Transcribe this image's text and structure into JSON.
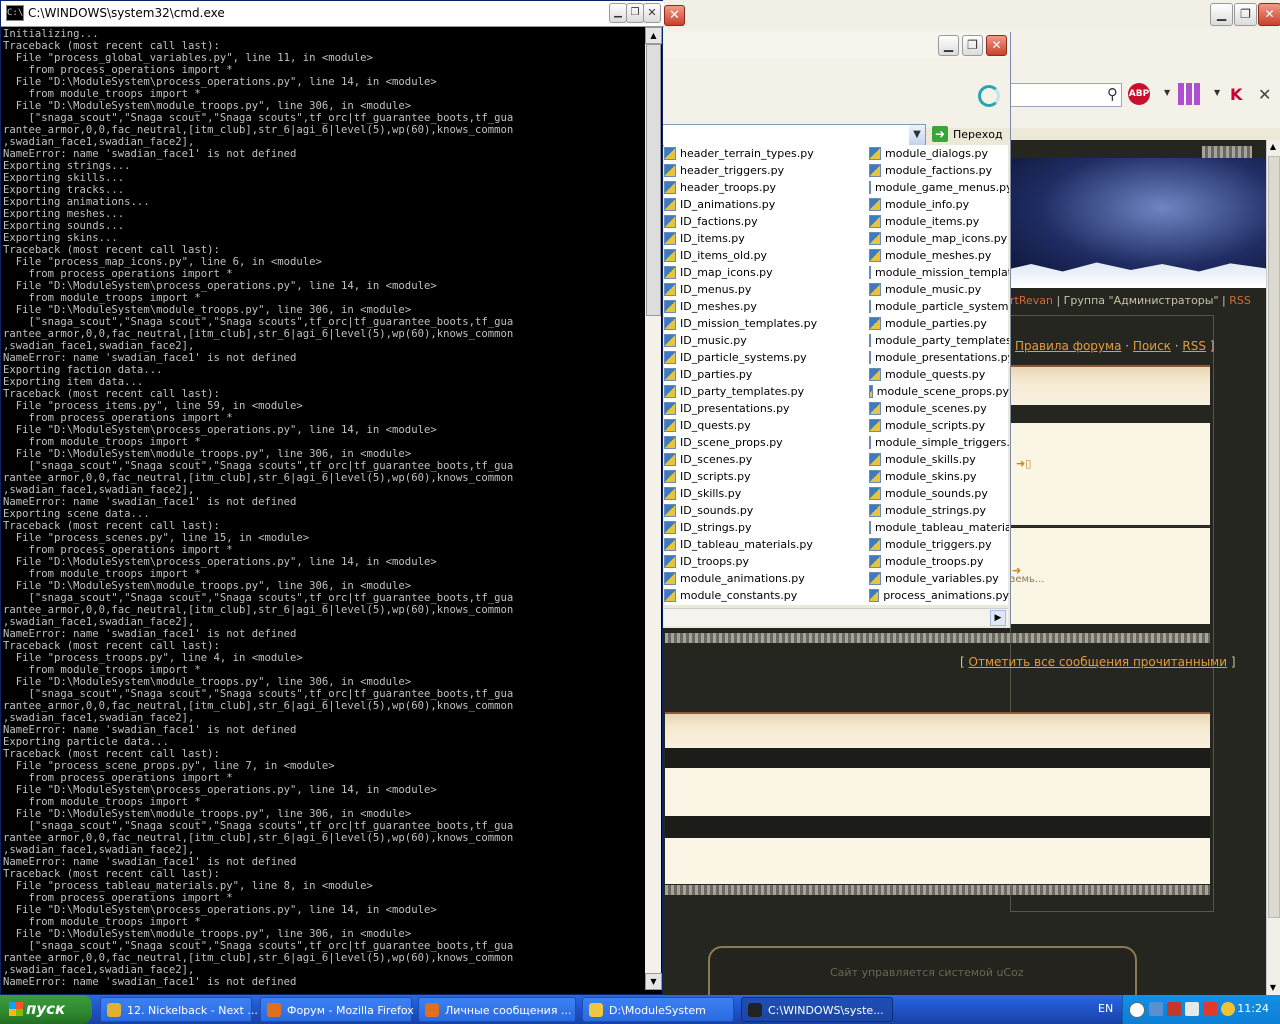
{
  "cmd": {
    "title": "C:\\WINDOWS\\system32\\cmd.exe",
    "lines": [
      "Initializing...",
      "Traceback (most recent call last):",
      "  File \"process_global_variables.py\", line 11, in <module>",
      "    from process_operations import *",
      "  File \"D:\\ModuleSystem\\process_operations.py\", line 14, in <module>",
      "    from module_troops import *",
      "  File \"D:\\ModuleSystem\\module_troops.py\", line 306, in <module>",
      "    [\"snaga_scout\",\"Snaga scout\",\"Snaga scouts\",tf_orc|tf_guarantee_boots,tf_gua",
      "rantee_armor,0,0,fac_neutral,[itm_club],str_6|agi_6|level(5),wp(60),knows_common",
      ",swadian_face1,swadian_face2],",
      "NameError: name 'swadian_face1' is not defined",
      "Exporting strings...",
      "Exporting skills...",
      "Exporting tracks...",
      "Exporting animations...",
      "Exporting meshes...",
      "Exporting sounds...",
      "Exporting skins...",
      "Traceback (most recent call last):",
      "  File \"process_map_icons.py\", line 6, in <module>",
      "    from process_operations import *",
      "  File \"D:\\ModuleSystem\\process_operations.py\", line 14, in <module>",
      "    from module_troops import *",
      "  File \"D:\\ModuleSystem\\module_troops.py\", line 306, in <module>",
      "    [\"snaga_scout\",\"Snaga scout\",\"Snaga scouts\",tf_orc|tf_guarantee_boots,tf_gua",
      "rantee_armor,0,0,fac_neutral,[itm_club],str_6|agi_6|level(5),wp(60),knows_common",
      ",swadian_face1,swadian_face2],",
      "NameError: name 'swadian_face1' is not defined",
      "Exporting faction data...",
      "Exporting item data...",
      "Traceback (most recent call last):",
      "  File \"process_items.py\", line 59, in <module>",
      "    from process_operations import *",
      "  File \"D:\\ModuleSystem\\process_operations.py\", line 14, in <module>",
      "    from module_troops import *",
      "  File \"D:\\ModuleSystem\\module_troops.py\", line 306, in <module>",
      "    [\"snaga_scout\",\"Snaga scout\",\"Snaga scouts\",tf_orc|tf_guarantee_boots,tf_gua",
      "rantee_armor,0,0,fac_neutral,[itm_club],str_6|agi_6|level(5),wp(60),knows_common",
      ",swadian_face1,swadian_face2],",
      "NameError: name 'swadian_face1' is not defined",
      "Exporting scene data...",
      "Traceback (most recent call last):",
      "  File \"process_scenes.py\", line 15, in <module>",
      "    from process_operations import *",
      "  File \"D:\\ModuleSystem\\process_operations.py\", line 14, in <module>",
      "    from module_troops import *",
      "  File \"D:\\ModuleSystem\\module_troops.py\", line 306, in <module>",
      "    [\"snaga_scout\",\"Snaga scout\",\"Snaga scouts\",tf_orc|tf_guarantee_boots,tf_gua",
      "rantee_armor,0,0,fac_neutral,[itm_club],str_6|agi_6|level(5),wp(60),knows_common",
      ",swadian_face1,swadian_face2],",
      "NameError: name 'swadian_face1' is not defined",
      "Traceback (most recent call last):",
      "  File \"process_troops.py\", line 4, in <module>",
      "    from module_troops import *",
      "  File \"D:\\ModuleSystem\\module_troops.py\", line 306, in <module>",
      "    [\"snaga_scout\",\"Snaga scout\",\"Snaga scouts\",tf_orc|tf_guarantee_boots,tf_gua",
      "rantee_armor,0,0,fac_neutral,[itm_club],str_6|agi_6|level(5),wp(60),knows_common",
      ",swadian_face1,swadian_face2],",
      "NameError: name 'swadian_face1' is not defined",
      "Exporting particle data...",
      "Traceback (most recent call last):",
      "  File \"process_scene_props.py\", line 7, in <module>",
      "    from process_operations import *",
      "  File \"D:\\ModuleSystem\\process_operations.py\", line 14, in <module>",
      "    from module_troops import *",
      "  File \"D:\\ModuleSystem\\module_troops.py\", line 306, in <module>",
      "    [\"snaga_scout\",\"Snaga scout\",\"Snaga scouts\",tf_orc|tf_guarantee_boots,tf_gua",
      "rantee_armor,0,0,fac_neutral,[itm_club],str_6|agi_6|level(5),wp(60),knows_common",
      ",swadian_face1,swadian_face2],",
      "NameError: name 'swadian_face1' is not defined",
      "Traceback (most recent call last):",
      "  File \"process_tableau_materials.py\", line 8, in <module>",
      "    from process_operations import *",
      "  File \"D:\\ModuleSystem\\process_operations.py\", line 14, in <module>",
      "    from module_troops import *",
      "  File \"D:\\ModuleSystem\\module_troops.py\", line 306, in <module>",
      "    [\"snaga_scout\",\"Snaga scout\",\"Snaga scouts\",tf_orc|tf_guarantee_boots,tf_gua",
      "rantee_armor,0,0,fac_neutral,[itm_club],str_6|agi_6|level(5),wp(60),knows_common",
      ",swadian_face1,swadian_face2],",
      "NameError: name 'swadian_face1' is not defined"
    ]
  },
  "explorer": {
    "go_label": "Переход",
    "files_left": [
      "header_terrain_types.py",
      "header_triggers.py",
      "header_troops.py",
      "ID_animations.py",
      "ID_factions.py",
      "ID_items.py",
      "ID_items_old.py",
      "ID_map_icons.py",
      "ID_menus.py",
      "ID_meshes.py",
      "ID_mission_templates.py",
      "ID_music.py",
      "ID_particle_systems.py",
      "ID_parties.py",
      "ID_party_templates.py",
      "ID_presentations.py",
      "ID_quests.py",
      "ID_scene_props.py",
      "ID_scenes.py",
      "ID_scripts.py",
      "ID_skills.py",
      "ID_sounds.py",
      "ID_strings.py",
      "ID_tableau_materials.py",
      "ID_troops.py",
      "module_animations.py",
      "module_constants.py"
    ],
    "files_right": [
      "module_dialogs.py",
      "module_factions.py",
      "module_game_menus.py",
      "module_info.py",
      "module_items.py",
      "module_map_icons.py",
      "module_meshes.py",
      "module_mission_templates",
      "module_music.py",
      "module_particle_systems.",
      "module_parties.py",
      "module_party_templates.",
      "module_presentations.py",
      "module_quests.py",
      "module_scene_props.py",
      "module_scenes.py",
      "module_scripts.py",
      "module_simple_triggers.py",
      "module_skills.py",
      "module_skins.py",
      "module_sounds.py",
      "module_strings.py",
      "module_tableau_materials",
      "module_triggers.py",
      "module_troops.py",
      "module_variables.py",
      "process_animations.py"
    ]
  },
  "firefox": {
    "abp_label": "ABP",
    "userline_user": "rtRevan",
    "userline_group": "| Группа \"Администраторы\" |",
    "userline_rss": "RSS",
    "nav_rules": "Правила форума",
    "nav_sep1": "·",
    "nav_search": "Поиск",
    "nav_sep2": "·",
    "nav_rss": "RSS",
    "nav_close": "]",
    "partial_text": "земь...",
    "mark_read_open": "[",
    "mark_read": "Отметить все сообщения прочитанными",
    "mark_read_close": "]",
    "footer_text": "Сайт управляется системой uCoz"
  },
  "taskbar": {
    "start_label": "пуск",
    "tasks": [
      {
        "label": "12. Nickelback - Next ...",
        "icon_color": "#e0b030"
      },
      {
        "label": "Форум - Mozilla Firefox",
        "icon_color": "#e07020"
      },
      {
        "label": "Личные сообщения ...",
        "icon_color": "#e07020"
      },
      {
        "label": "D:\\ModuleSystem",
        "icon_color": "#f0c840"
      },
      {
        "label": "C:\\WINDOWS\\syste...",
        "icon_color": "#222222"
      }
    ],
    "language": "EN",
    "clock": "11:24"
  }
}
